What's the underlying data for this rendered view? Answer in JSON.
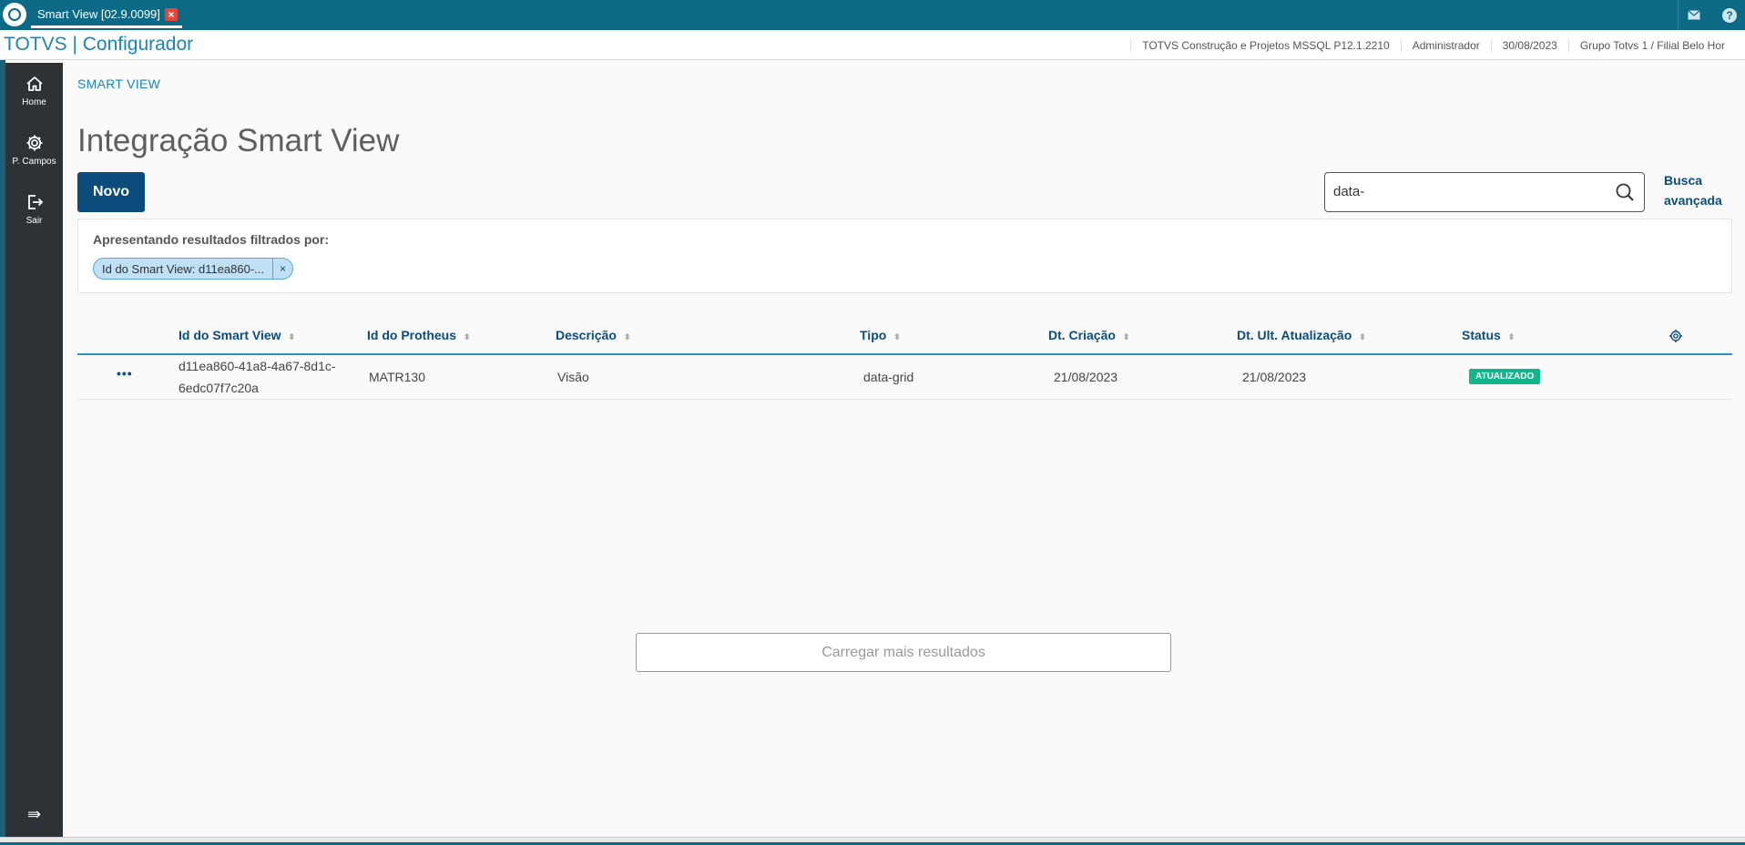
{
  "titlebar": {
    "tab_label": "Smart View [02.9.0099]",
    "tab_close": "×",
    "mail_icon": "mail-icon",
    "help_icon": "?"
  },
  "header": {
    "app_title": "TOTVS | Configurador",
    "company": "TOTVS Construção e Projetos MSSQL P12.1.2210",
    "user": "Administrador",
    "date": "30/08/2023",
    "branch": "Grupo Totvs 1 / Filial Belo Hor"
  },
  "sidebar": {
    "items": [
      {
        "label": "Home",
        "icon": "home-icon"
      },
      {
        "label": "P. Campos",
        "icon": "gear-icon"
      },
      {
        "label": "Sair",
        "icon": "logout-icon"
      }
    ],
    "collapse": "⇛"
  },
  "main": {
    "breadcrumb": "SMART VIEW",
    "title": "Integração Smart View",
    "new_button": "Novo",
    "search_value": "data-",
    "advanced_search": "Busca avançada"
  },
  "filter": {
    "label": "Apresentando resultados filtrados por:",
    "chip_text": "Id do Smart View: d11ea860-...",
    "chip_close": "×"
  },
  "table": {
    "columns": [
      "Id do Smart View",
      "Id do Protheus",
      "Descrição",
      "Tipo",
      "Dt. Criação",
      "Dt. Ult. Atualização",
      "Status"
    ],
    "sort_icon": "⬍",
    "rows": [
      {
        "actions": "•••",
        "id_smart_view": "d11ea860-41a8-4a67-8d1c-6edc07f7c20a",
        "id_protheus": "MATR130",
        "descricao": "Visão",
        "tipo": "data-grid",
        "dt_criacao": "21/08/2023",
        "dt_atualizacao": "21/08/2023",
        "status": "ATUALIZADO"
      }
    ]
  },
  "load_more": "Carregar mais resultados",
  "colors": {
    "titlebar": "#0c6a87",
    "primary": "#0c4c7c",
    "accent": "#1a86b5",
    "status_ok": "#13b58a",
    "sidebar": "#2c3236"
  }
}
